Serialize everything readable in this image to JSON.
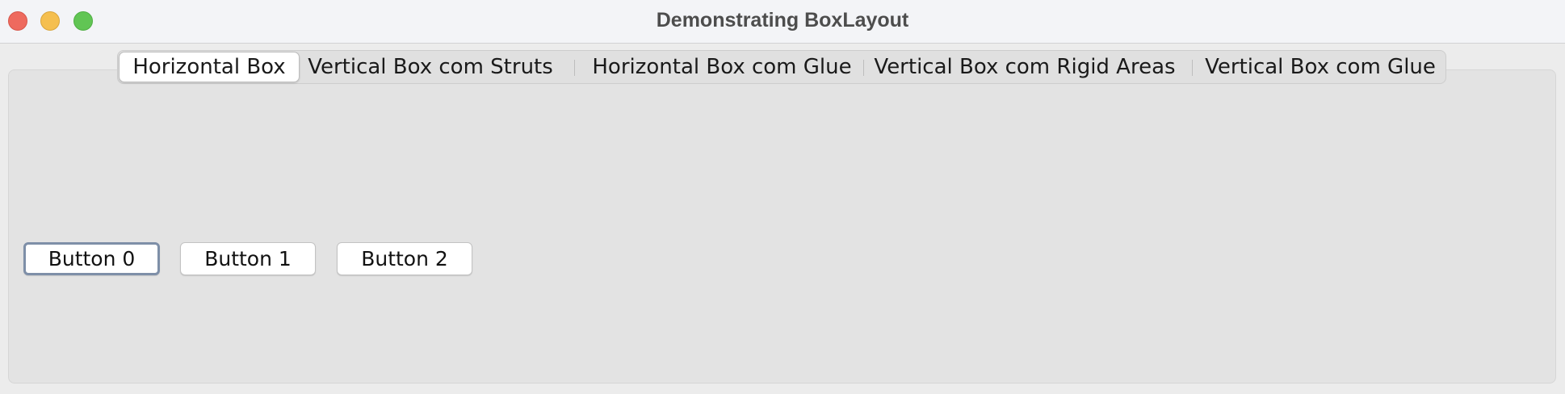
{
  "window": {
    "title": "Demonstrating BoxLayout",
    "controls": {
      "close_icon": "close-icon",
      "minimize_icon": "minimize-icon",
      "zoom_icon": "zoom-icon",
      "close_color": "#ee6a5e",
      "minimize_color": "#f5bf4f",
      "zoom_color": "#61c554"
    }
  },
  "tabs": [
    {
      "label": "Horizontal Box",
      "selected": true
    },
    {
      "label": "Vertical Box com Struts",
      "selected": false
    },
    {
      "label": "Horizontal Box com Glue",
      "selected": false
    },
    {
      "label": "Vertical Box com Rigid Areas",
      "selected": false
    },
    {
      "label": "Vertical Box com Glue",
      "selected": false
    }
  ],
  "panel": {
    "buttons": [
      {
        "label": "Button 0",
        "focused": true
      },
      {
        "label": "Button 1",
        "focused": false
      },
      {
        "label": "Button 2",
        "focused": false
      }
    ]
  }
}
